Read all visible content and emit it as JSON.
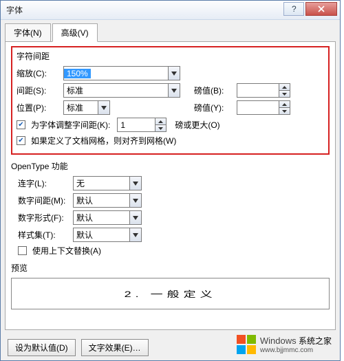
{
  "title": "字体",
  "tabs": {
    "font": "字体(N)",
    "advanced": "高级(V)"
  },
  "charSpacing": {
    "group": "字符间距",
    "scaleLabel": "缩放(C):",
    "scaleValue": "150%",
    "spacingLabel": "间距(S):",
    "spacingValue": "标准",
    "posLabel": "位置(P):",
    "posValue": "标准",
    "ptLabelB": "磅值(B):",
    "ptValueB": "",
    "ptLabelY": "磅值(Y):",
    "ptValueY": "",
    "kerningLabel": "为字体调整字间距(K):",
    "kerningValue": "1",
    "kerningSuffix": "磅或更大(O)",
    "gridLabel": "如果定义了文档网格，则对齐到网格(W)"
  },
  "opentype": {
    "group": "OpenType 功能",
    "ligLabel": "连字(L):",
    "ligValue": "无",
    "numSpLabel": "数字间距(M):",
    "numSpValue": "默认",
    "numFormLabel": "数字形式(F):",
    "numFormValue": "默认",
    "styleSetLabel": "样式集(T):",
    "styleSetValue": "默认",
    "contextLabel": "使用上下文替换(A)"
  },
  "preview": {
    "label": "预览",
    "text": "2.  一般定义"
  },
  "footer": {
    "default": "设为默认值(D)",
    "effects": "文字效果(E)…"
  },
  "watermark": {
    "brand": "Windows",
    "sub": "系统之家",
    "site": "www.bjjmmc.com"
  },
  "logoColors": {
    "tl": "#f25022",
    "tr": "#7fba00",
    "bl": "#00a4ef",
    "br": "#ffb900"
  }
}
